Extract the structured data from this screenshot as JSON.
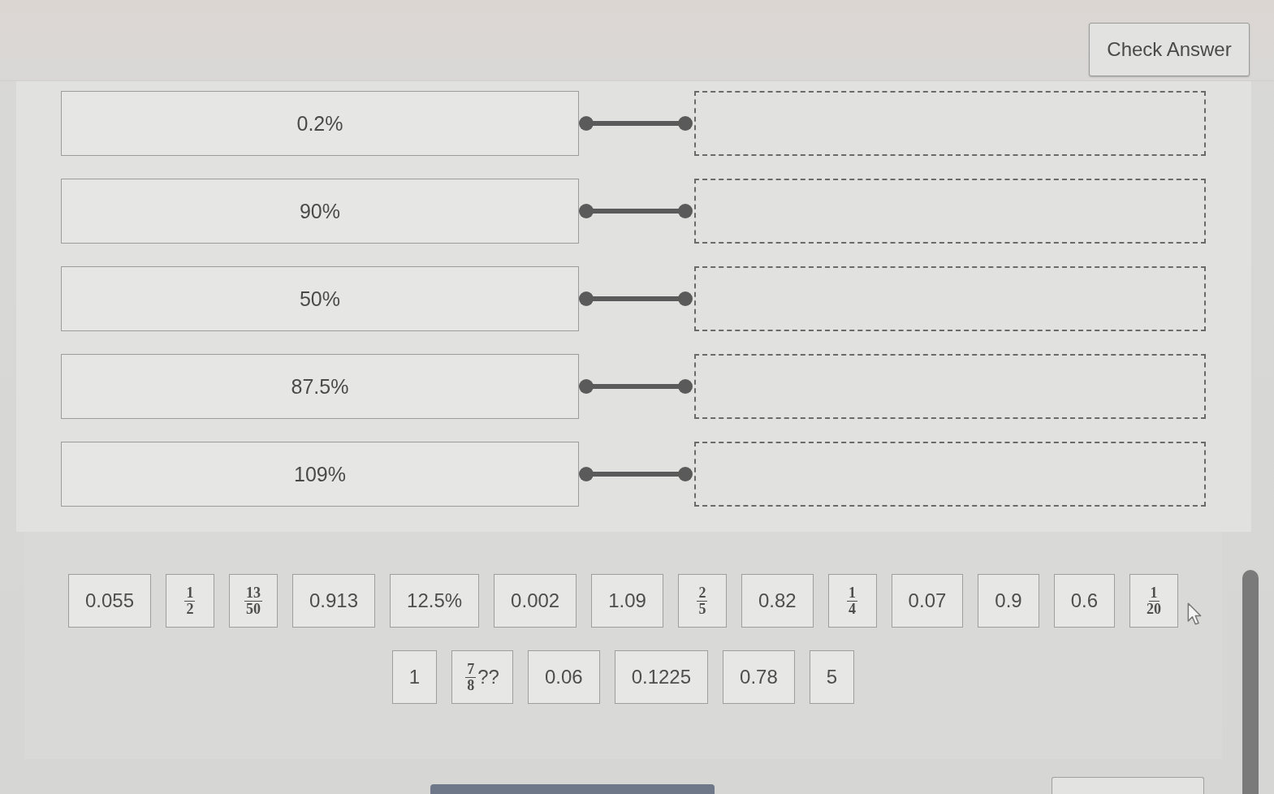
{
  "header": {
    "check_button": "Check Answer"
  },
  "pairs": [
    {
      "prompt": "0.2%"
    },
    {
      "prompt": "90%"
    },
    {
      "prompt": "50%"
    },
    {
      "prompt": "87.5%"
    },
    {
      "prompt": "109%"
    }
  ],
  "tile_rows": [
    [
      {
        "kind": "number",
        "text": "0.055"
      },
      {
        "kind": "fraction",
        "numerator": "1",
        "denominator": "2"
      },
      {
        "kind": "fraction",
        "numerator": "13",
        "denominator": "50"
      },
      {
        "kind": "number",
        "text": "0.913"
      },
      {
        "kind": "number",
        "text": "12.5%"
      },
      {
        "kind": "number",
        "text": "0.002"
      },
      {
        "kind": "number",
        "text": "1.09"
      },
      {
        "kind": "fraction",
        "numerator": "2",
        "denominator": "5"
      },
      {
        "kind": "number",
        "text": "0.82"
      },
      {
        "kind": "fraction",
        "numerator": "1",
        "denominator": "4"
      },
      {
        "kind": "number",
        "text": "0.07"
      },
      {
        "kind": "number",
        "text": "0.9"
      },
      {
        "kind": "number",
        "text": "0.6"
      },
      {
        "kind": "fraction",
        "numerator": "1",
        "denominator": "20"
      }
    ],
    [
      {
        "kind": "number",
        "text": "1"
      },
      {
        "kind": "fraction",
        "numerator": "7",
        "denominator": "8",
        "suffix": "??"
      },
      {
        "kind": "number",
        "text": "0.06"
      },
      {
        "kind": "number",
        "text": "0.1225"
      },
      {
        "kind": "number",
        "text": "0.78"
      },
      {
        "kind": "number",
        "text": "5"
      }
    ]
  ]
}
